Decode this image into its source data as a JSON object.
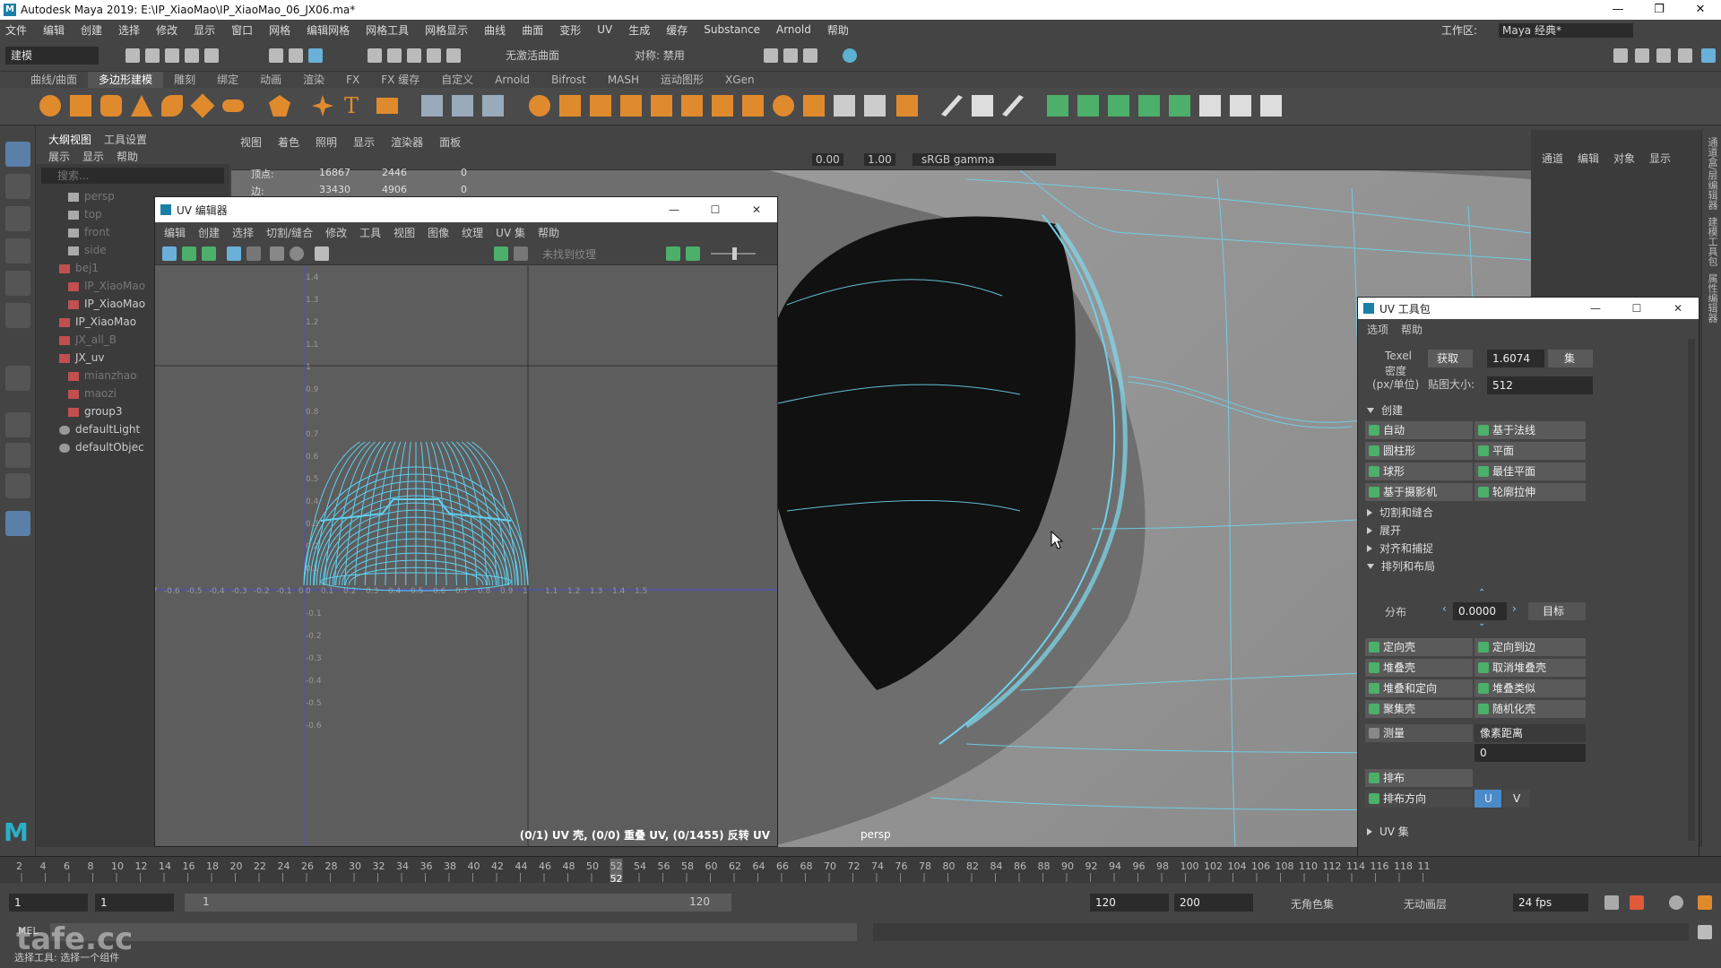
{
  "titlebar": {
    "title": "Autodesk Maya 2019: E:\\IP_XiaoMao\\IP_XiaoMao_06_JX06.ma*",
    "minimize": "—",
    "maximize": "❐",
    "close": "✕"
  },
  "menubar": {
    "items": [
      "文件",
      "编辑",
      "创建",
      "选择",
      "修改",
      "显示",
      "窗口",
      "网格",
      "编辑网格",
      "网格工具",
      "网格显示",
      "曲线",
      "曲面",
      "变形",
      "UV",
      "生成",
      "缓存",
      "Substance",
      "Arnold",
      "帮助"
    ],
    "workspace_label": "工作区:",
    "workspace_value": "Maya 经典*"
  },
  "statusline": {
    "mode": "建模",
    "live_surface": "无激活曲面",
    "symmetry": "对称: 禁用"
  },
  "shelf": {
    "tabs": [
      "曲线/曲面",
      "多边形建模",
      "雕刻",
      "绑定",
      "动画",
      "渲染",
      "FX",
      "FX 缓存",
      "自定义",
      "Arnold",
      "Bifrost",
      "MASH",
      "运动图形",
      "XGen"
    ],
    "active_tab": "多边形建模"
  },
  "outliner": {
    "tabs": [
      "大纲视图",
      "工具设置"
    ],
    "menu": [
      "展示",
      "显示",
      "帮助"
    ],
    "search_placeholder": "搜索...",
    "items": [
      {
        "label": "persp",
        "dim": true,
        "indent": 1
      },
      {
        "label": "top",
        "dim": true,
        "indent": 1
      },
      {
        "label": "front",
        "dim": true,
        "indent": 1
      },
      {
        "label": "side",
        "dim": true,
        "indent": 1
      },
      {
        "label": "bej1",
        "dim": true,
        "indent": 0
      },
      {
        "label": "IP_XiaoMao",
        "dim": true,
        "indent": 1
      },
      {
        "label": "IP_XiaoMao",
        "dim": false,
        "indent": 1
      },
      {
        "label": "IP_XiaoMao",
        "dim": false,
        "indent": 0
      },
      {
        "label": "JX_all_B",
        "dim": true,
        "indent": 0
      },
      {
        "label": "JX_uv",
        "dim": false,
        "indent": 0
      },
      {
        "label": "mianzhao",
        "dim": true,
        "indent": 1
      },
      {
        "label": "maozi",
        "dim": true,
        "indent": 1
      },
      {
        "label": "group3",
        "dim": false,
        "indent": 1
      },
      {
        "label": "defaultLight",
        "dim": false,
        "indent": 0
      },
      {
        "label": "defaultObjec",
        "dim": false,
        "indent": 0
      }
    ]
  },
  "viewport": {
    "menu": [
      "视图",
      "着色",
      "照明",
      "显示",
      "渲染器",
      "面板"
    ],
    "exposure": "0.00",
    "gamma": "1.00",
    "colorspace": "sRGB gamma",
    "camera_label": "persp",
    "hud": {
      "row1_label": "顶点:",
      "row1_a": "16867",
      "row1_b": "2446",
      "row1_c": "0",
      "row2_label": "边:",
      "row2_a": "33430",
      "row2_b": "4906",
      "row2_c": "0"
    }
  },
  "channelbox": {
    "menu": [
      "通道",
      "编辑",
      "对象",
      "显示"
    ]
  },
  "sidetabs": [
    "通道盒/层编辑器",
    "建模工具包",
    "属性编辑器"
  ],
  "uv_editor": {
    "title": "UV 编辑器",
    "menu": [
      "编辑",
      "创建",
      "选择",
      "切割/缝合",
      "修改",
      "工具",
      "视图",
      "图像",
      "纹理",
      "UV 集",
      "帮助"
    ],
    "texture_dd": "未找到纹理",
    "status": "(0/1) UV 壳, (0/0) 重叠 UV, (0/1455) 反转 UV",
    "yticks": [
      "1.4",
      "1.3",
      "1.2",
      "1.1",
      "1",
      "0.9",
      "0.8",
      "0.7",
      "0.6",
      "0.5",
      "0.4",
      "0.3",
      "0.2",
      "0.1",
      "0",
      "-0.1",
      "-0.2",
      "-0.3",
      "-0.4",
      "-0.5",
      "-0.6"
    ],
    "xticks": [
      "-0.7",
      "-0.6",
      "-0.5",
      "-0.4",
      "-0.3",
      "-0.2",
      "-0.1",
      "0",
      "0.1",
      "0.2",
      "0.3",
      "0.4",
      "0.5",
      "0.6",
      "0.7",
      "0.8",
      "0.9",
      "1",
      "1.1",
      "1.2",
      "1.3",
      "1.4",
      "1.5"
    ]
  },
  "uv_toolkit": {
    "title": "UV 工具包",
    "menu": [
      "选项",
      "帮助"
    ],
    "texel_label": "Texel",
    "density_label": "密度",
    "unit_label": "(px/单位)",
    "get_btn": "获取",
    "texel_value": "1.6074",
    "set_btn": "集",
    "map_size_label": "贴图大小:",
    "map_size_value": "512",
    "create_section": "创建",
    "create_buttons": [
      "自动",
      "基于法线",
      "圆柱形",
      "平面",
      "球形",
      "最佳平面",
      "基于摄影机",
      "轮廓拉伸"
    ],
    "collapsed": [
      "切割和缝合",
      "展开",
      "对齐和捕捉"
    ],
    "arrange_section": "排列和布局",
    "distribute_label": "分布",
    "distribute_value": "0.0000",
    "target_btn": "目标",
    "arrange_buttons": [
      "定向壳",
      "定向到边",
      "堆叠壳",
      "取消堆叠壳",
      "堆叠和定向",
      "堆叠类似",
      "聚集壳",
      "随机化壳"
    ],
    "measure_label": "测量",
    "measure_dd": "像素距离",
    "measure_value": "0",
    "layout_btn": "排布",
    "layout_dir_label": "排布方向",
    "dir_u": "U",
    "dir_v": "V",
    "uvset_section": "UV 集"
  },
  "timeslider": {
    "ticks": [
      "2",
      "4",
      "6",
      "8",
      "10",
      "12",
      "14",
      "16",
      "18",
      "20",
      "22",
      "24",
      "26",
      "28",
      "30",
      "32",
      "34",
      "36",
      "38",
      "40",
      "42",
      "44",
      "46",
      "48",
      "50",
      "52",
      "54",
      "56",
      "58",
      "60",
      "62",
      "64",
      "66",
      "68",
      "70",
      "72",
      "74",
      "76",
      "78",
      "80",
      "82",
      "84",
      "86",
      "88",
      "90",
      "92",
      "94",
      "96",
      "98",
      "100",
      "102",
      "104",
      "106",
      "108",
      "110",
      "112",
      "114",
      "116",
      "118",
      "11"
    ],
    "current": "52"
  },
  "range": {
    "start": "1",
    "start2": "1",
    "inner_start": "1",
    "inner_end": "120",
    "end": "120",
    "end2": "200",
    "char_set": "无角色集",
    "anim_layer": "无动画层",
    "fps": "24 fps"
  },
  "cmdline": {
    "lang": "MEL",
    "help": "选择工具: 选择一个组件",
    "watermark": "tafe.cc"
  }
}
